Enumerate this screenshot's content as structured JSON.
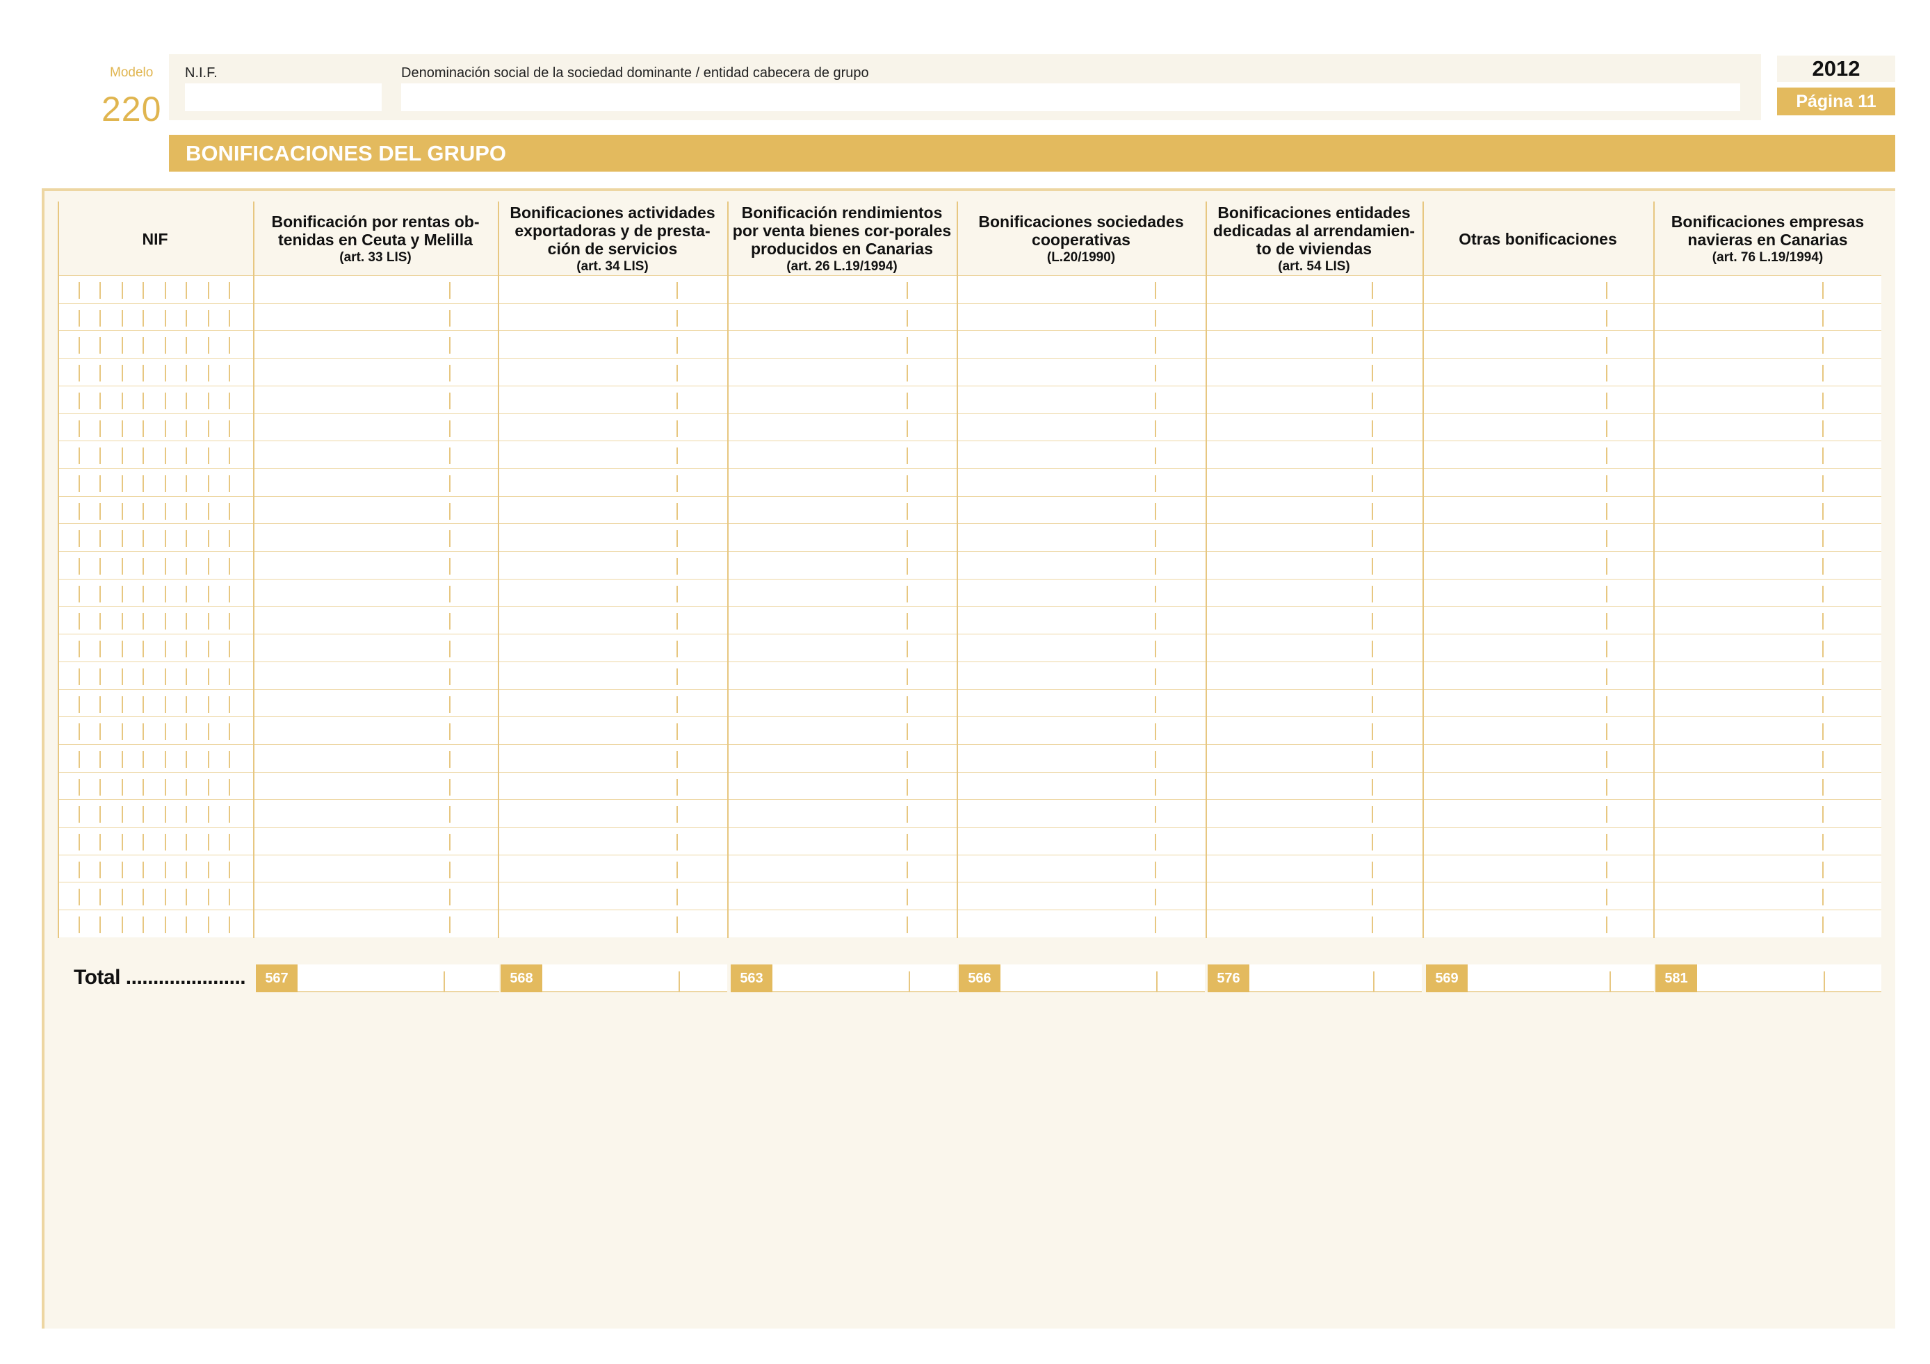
{
  "header": {
    "modelo_label": "Modelo",
    "modelo_number": "220",
    "nif_label": "N.I.F.",
    "nif_value": "",
    "denominacion_label": "Denominación social de la sociedad dominante / entidad cabecera de grupo",
    "denominacion_value": "",
    "year": "2012",
    "page": "Página 11"
  },
  "section_title": "BONIFICACIONES DEL GRUPO",
  "table": {
    "columns": [
      {
        "label": "NIF",
        "sub": ""
      },
      {
        "label": "Bonificación por rentas ob-tenidas en Ceuta y Melilla",
        "sub": "(art. 33 LIS)"
      },
      {
        "label": "Bonificaciones actividades exportadoras y de presta-ción de servicios",
        "sub": "(art. 34 LIS)"
      },
      {
        "label": "Bonificación rendimientos por venta bienes cor-porales producidos en Canarias",
        "sub": "(art. 26 L.19/1994)"
      },
      {
        "label": "Bonificaciones sociedades cooperativas",
        "sub": "(L.20/1990)"
      },
      {
        "label": "Bonificaciones entidades dedicadas al arrendamien-to de viviendas",
        "sub": "(art. 54 LIS)"
      },
      {
        "label": "Otras bonificaciones",
        "sub": ""
      },
      {
        "label": "Bonificaciones empresas navieras en Canarias",
        "sub": "(art. 76 L.19/1994)"
      }
    ],
    "row_count": 24
  },
  "total": {
    "label": "Total ......................",
    "codes": [
      "567",
      "568",
      "563",
      "566",
      "576",
      "569",
      "581"
    ]
  },
  "colors": {
    "accent": "#e3ba5e",
    "panel_bg": "#faf6ec",
    "rule": "#e7c781"
  }
}
